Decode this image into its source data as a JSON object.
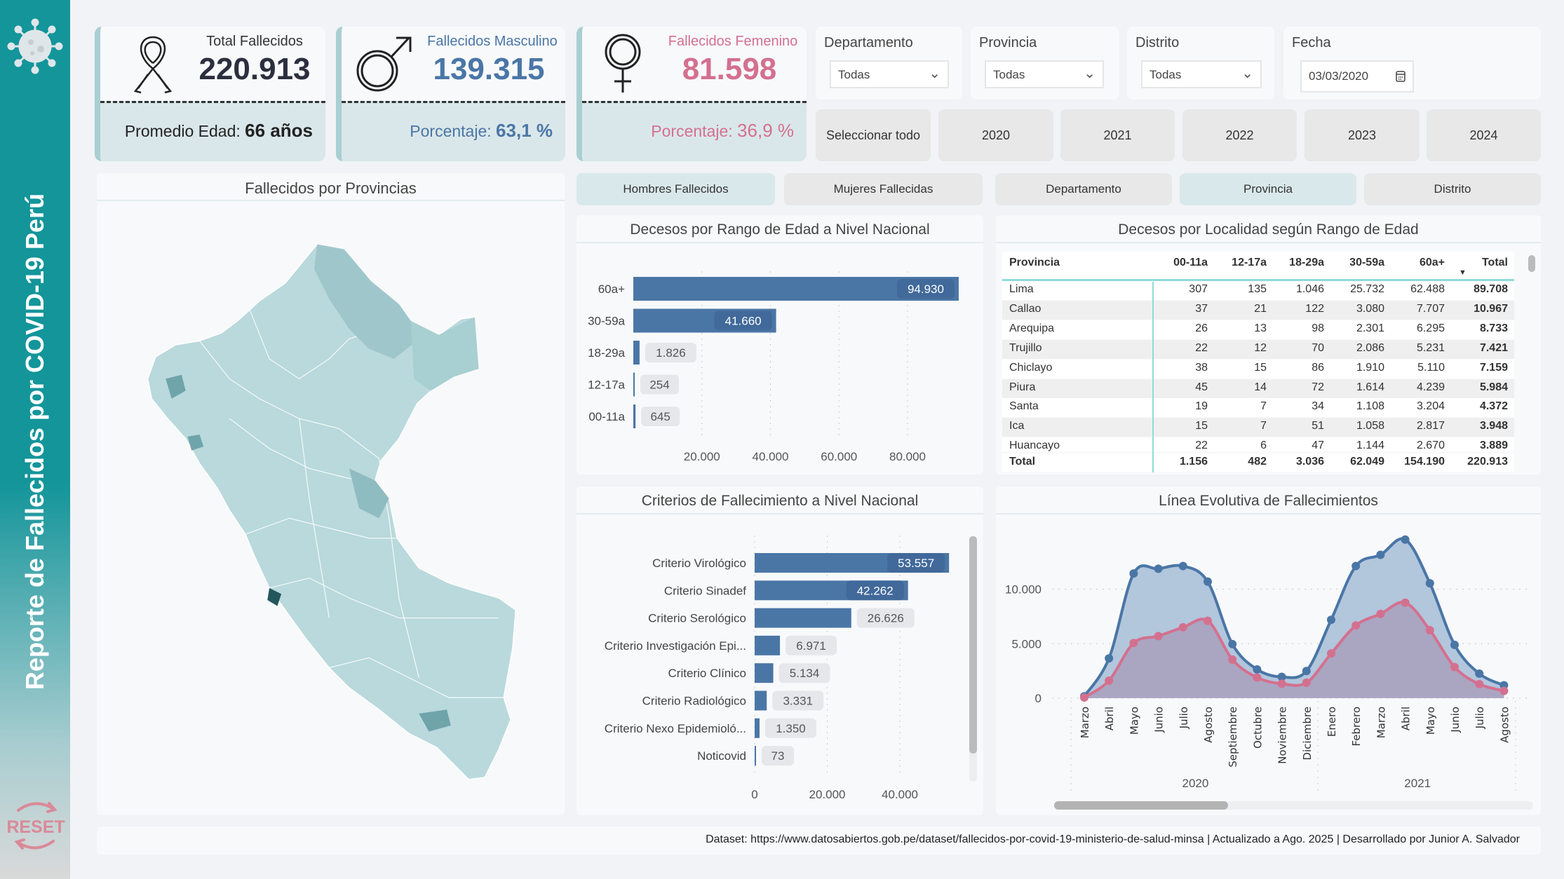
{
  "sidebar": {
    "title": "Reporte de Fallecidos por COVID-19 Perú",
    "reset_label": "RESET",
    "logo_icon": "virus-icon",
    "accent": "#13959a"
  },
  "kpis": [
    {
      "label": "Total Fallecidos",
      "value": "220.913",
      "sub_label": "Promedio Edad:",
      "sub_value": "66 años",
      "icon": "ribbon-icon",
      "color": "#2b2f3e"
    },
    {
      "label": "Fallecidos Masculino",
      "value": "139.315",
      "sub_label": "Porcentaje:",
      "sub_value": "63,1 %",
      "icon": "male-icon",
      "color": "#4a76a6"
    },
    {
      "label": "Fallecidos Femenino",
      "value": "81.598",
      "sub_label": "Porcentaje:",
      "sub_value": "36,9 %",
      "icon": "female-icon",
      "color": "#d4708f"
    }
  ],
  "filters": {
    "departamento": {
      "label": "Departamento",
      "value": "Todas"
    },
    "provincia": {
      "label": "Provincia",
      "value": "Todas"
    },
    "distrito": {
      "label": "Distrito",
      "value": "Todas"
    },
    "fecha": {
      "label": "Fecha",
      "value": "03/03/2020"
    }
  },
  "years": [
    "Seleccionar todo",
    "2020",
    "2021",
    "2022",
    "2023",
    "2024"
  ],
  "tabs": [
    {
      "label": "Hombres Fallecidos",
      "active": true
    },
    {
      "label": "Mujeres Fallecidas",
      "active": false
    },
    {
      "label": "Departamento",
      "active": false
    },
    {
      "label": "Provincia",
      "active": true
    },
    {
      "label": "Distrito",
      "active": false
    }
  ],
  "map": {
    "title": "Fallecidos por Provincias"
  },
  "chart_data": [
    {
      "type": "bar",
      "orientation": "horizontal",
      "title": "Decesos por Rango de Edad a Nivel Nacional",
      "categories": [
        "60a+",
        "30-59a",
        "18-29a",
        "12-17a",
        "00-11a"
      ],
      "values": [
        94930,
        41660,
        1826,
        254,
        645
      ],
      "labels": [
        "94.930",
        "41.660",
        "1.826",
        "254",
        "645"
      ],
      "xticks": [
        "20.000",
        "40.000",
        "60.000",
        "80.000"
      ],
      "xtick_values": [
        20000,
        40000,
        60000,
        80000
      ],
      "xlim": [
        0,
        95000
      ],
      "color": "#4a76a6"
    },
    {
      "type": "bar",
      "orientation": "horizontal",
      "title": "Criterios de Fallecimiento a Nivel Nacional",
      "categories": [
        "Criterio Virológico",
        "Criterio Sinadef",
        "Criterio Serológico",
        "Criterio Investigación Epi...",
        "Criterio Clínico",
        "Criterio Radiológico",
        "Criterio Nexo Epidemioló...",
        "Noticovid"
      ],
      "values": [
        53557,
        42262,
        26626,
        6971,
        5134,
        3331,
        1350,
        73
      ],
      "labels": [
        "53.557",
        "42.262",
        "26.626",
        "6.971",
        "5.134",
        "3.331",
        "1.350",
        "73"
      ],
      "xticks": [
        "0",
        "20.000",
        "40.000"
      ],
      "xtick_values": [
        0,
        20000,
        40000
      ],
      "xlim": [
        0,
        54000
      ],
      "color": "#4a76a6"
    },
    {
      "type": "area",
      "title": "Línea Evolutiva de Fallecimientos",
      "x": [
        "Marzo",
        "Abril",
        "Mayo",
        "Junio",
        "Julio",
        "Agosto",
        "Septiembre",
        "Octubre",
        "Noviembre",
        "Diciembre",
        "Enero",
        "Febrero",
        "Marzo",
        "Abril",
        "Mayo",
        "Junio",
        "Julio",
        "Agosto"
      ],
      "x_groups": [
        {
          "label": "2020",
          "count": 10
        },
        {
          "label": "2021",
          "count": 8
        }
      ],
      "series": [
        {
          "values": [
            170,
            3650,
            11440,
            11870,
            12120,
            10690,
            4960,
            2640,
            1950,
            2490,
            7190,
            12120,
            13150,
            14550,
            10540,
            4890,
            2250,
            1180
          ],
          "color": "#4a76a6"
        },
        {
          "values": [
            60,
            1610,
            5060,
            5690,
            6500,
            7100,
            3540,
            1890,
            1330,
            1420,
            4100,
            6670,
            7730,
            8760,
            6240,
            2850,
            1290,
            670
          ],
          "color": "#d4708f"
        }
      ],
      "yticks": [
        "0",
        "5.000",
        "10.000"
      ],
      "ytick_values": [
        0,
        5000,
        10000
      ],
      "ylim": [
        0,
        15000
      ],
      "grid": true
    }
  ],
  "table": {
    "title": "Decesos por Localidad según Rango de Edad",
    "columns": [
      "Provincia",
      "00-11a",
      "12-17a",
      "18-29a",
      "30-59a",
      "60a+",
      "Total"
    ],
    "rows": [
      [
        "Lima",
        "307",
        "135",
        "1.046",
        "25.732",
        "62.488",
        "89.708"
      ],
      [
        "Callao",
        "37",
        "21",
        "122",
        "3.080",
        "7.707",
        "10.967"
      ],
      [
        "Arequipa",
        "26",
        "13",
        "98",
        "2.301",
        "6.295",
        "8.733"
      ],
      [
        "Trujillo",
        "22",
        "12",
        "70",
        "2.086",
        "5.231",
        "7.421"
      ],
      [
        "Chiclayo",
        "38",
        "15",
        "86",
        "1.910",
        "5.110",
        "7.159"
      ],
      [
        "Piura",
        "45",
        "14",
        "72",
        "1.614",
        "4.239",
        "5.984"
      ],
      [
        "Santa",
        "19",
        "7",
        "34",
        "1.108",
        "3.204",
        "4.372"
      ],
      [
        "Ica",
        "15",
        "7",
        "51",
        "1.058",
        "2.817",
        "3.948"
      ],
      [
        "Huancayo",
        "22",
        "6",
        "47",
        "1.144",
        "2.670",
        "3.889"
      ]
    ],
    "total": [
      "Total",
      "1.156",
      "482",
      "3.036",
      "62.049",
      "154.190",
      "220.913"
    ]
  },
  "footer": "Dataset: https://www.datosabiertos.gob.pe/dataset/fallecidos-por-covid-19-ministerio-de-salud-minsa | Actualizado a Ago. 2025 | Desarrollado por Junior A. Salvador"
}
